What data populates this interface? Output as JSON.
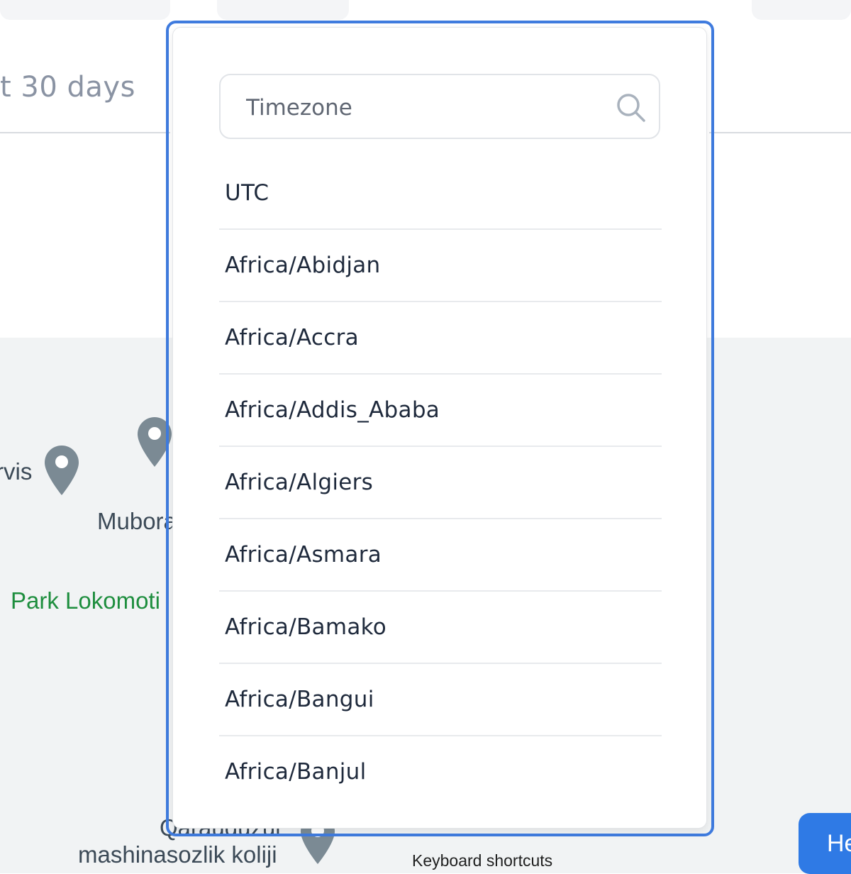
{
  "background": {
    "period_label": "t 30 days"
  },
  "map": {
    "labels": [
      {
        "id": "servis",
        "text": "rvis"
      },
      {
        "id": "muborak",
        "text": "Mubora"
      },
      {
        "id": "park",
        "text": "Park Lokomoti"
      },
      {
        "id": "qarauduz",
        "text": "Qarauduzui"
      },
      {
        "id": "mashina",
        "text": "mashinasozlik koliji"
      }
    ],
    "keyboard_shortcuts": "Keyboard shortcuts",
    "help_label": "He",
    "colors": {
      "pin": "#7b8a94",
      "park_text": "#1e8e3e",
      "label_text": "#3c4a57"
    }
  },
  "dropdown": {
    "search": {
      "placeholder": "Timezone",
      "value": ""
    },
    "options": [
      "UTC",
      "Africa/Abidjan",
      "Africa/Accra",
      "Africa/Addis_Ababa",
      "Africa/Algiers",
      "Africa/Asmara",
      "Africa/Bamako",
      "Africa/Bangui",
      "Africa/Banjul"
    ],
    "colors": {
      "focus_ring": "#3f7bde",
      "text": "#1f2a3c"
    }
  }
}
